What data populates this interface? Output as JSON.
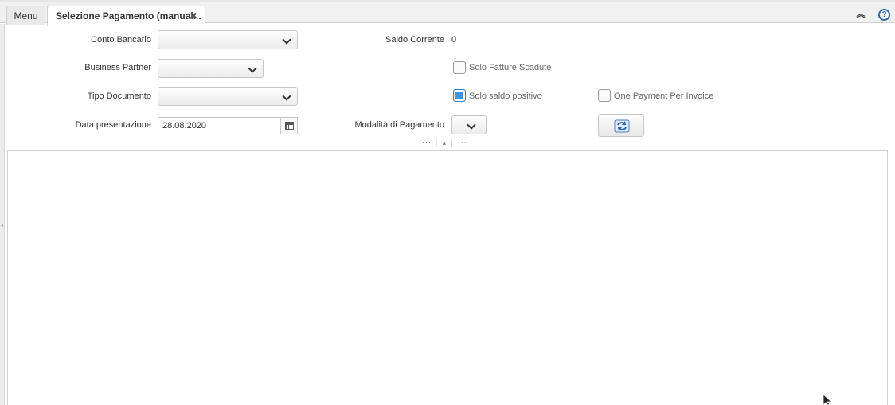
{
  "tabs": {
    "menu_label": "Menu",
    "active_label": "Selezione Pagamento (manual...",
    "close_glyph": "✖"
  },
  "icons": {
    "collapse": "double-chevron-up-icon",
    "help": "help-icon",
    "calendar": "calendar-icon",
    "refresh": "refresh-icon"
  },
  "form": {
    "bank_account_label": "Conto Bancario",
    "bank_account_value": "",
    "current_balance_label": "Saldo Corrente",
    "current_balance_value": "0",
    "business_partner_label": "Business Partner",
    "business_partner_value": "",
    "only_overdue_label": "Solo Fatture Scadute",
    "only_overdue_checked": false,
    "doc_type_label": "Tipo Documento",
    "doc_type_value": "",
    "only_positive_label": "Solo saldo positivo",
    "only_positive_checked": true,
    "one_payment_label": "One Payment Per Invoice",
    "one_payment_checked": false,
    "pay_date_label": "Data presentazione",
    "pay_date_value": "28.08.2020",
    "payment_rule_label": "Modalità di Pagamento",
    "payment_rule_value": ""
  },
  "colors": {
    "accent": "#3b95e6",
    "help": "#2b6aa8"
  }
}
